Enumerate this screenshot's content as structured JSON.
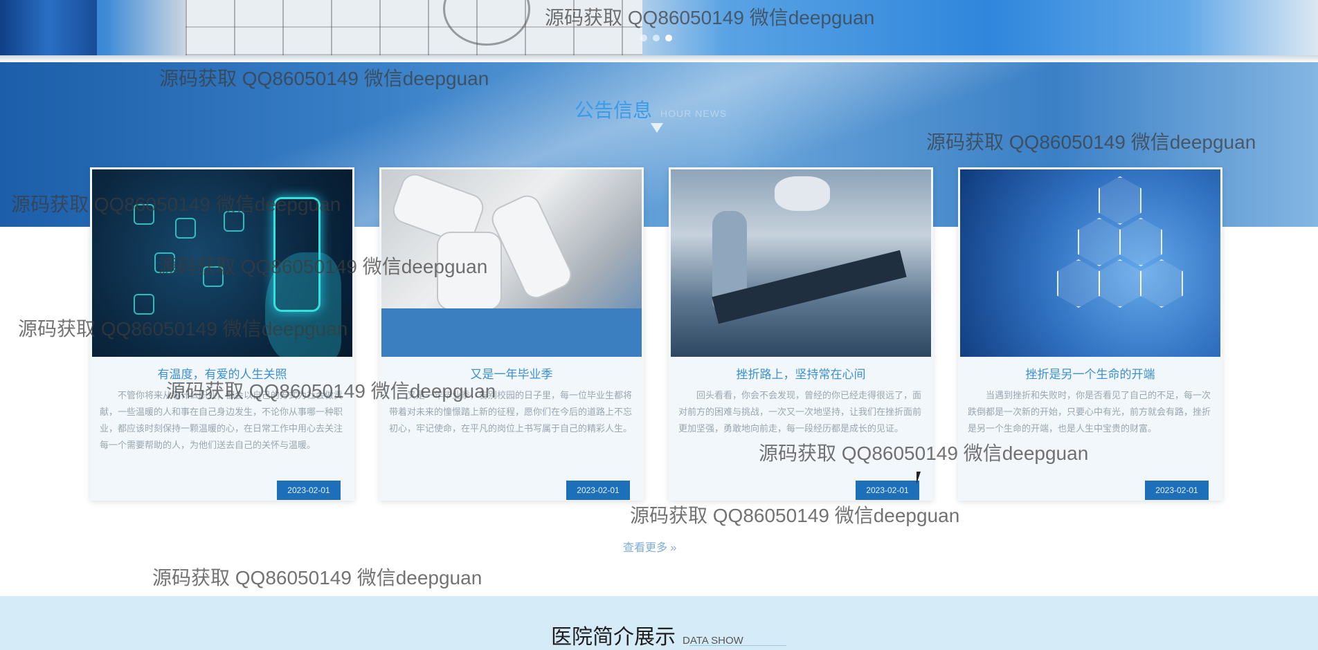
{
  "banner": {
    "slogan": "",
    "dots": 3
  },
  "news": {
    "title": "公告信息",
    "subtitle": "HOUR NEWS",
    "cards": [
      {
        "title": "有温度，有爱的人生关照",
        "summary": "不管你将来从事什么职业，都会以自己的方式为社会做贡献，一些温暖的人和事在自己身边发生，不论你从事哪一种职业，都应该时刻保持一颗温暖的心，在日常工作中用心去关注每一个需要帮助的人，为他们送去自己的关怀与温暖。",
        "date": "2023-02-01"
      },
      {
        "title": "又是一年毕业季",
        "summary": "又是一年毕业季，告别校园的日子里，每一位毕业生都将带着对未来的憧憬踏上新的征程，愿你们在今后的道路上不忘初心，牢记使命，在平凡的岗位上书写属于自己的精彩人生。",
        "date": "2023-02-01"
      },
      {
        "title": "挫折路上，坚持常在心间",
        "summary": "回头看看，你会不会发现，曾经的你已经走得很远了，面对前方的困难与挑战，一次又一次地坚持，让我们在挫折面前更加坚强，勇敢地向前走，每一段经历都是成长的见证。",
        "date": "2023-02-01"
      },
      {
        "title": "挫折是另一个生命的开端",
        "summary": "当遇到挫折和失败时，你是否看见了自己的不足，每一次跌倒都是一次新的开始，只要心中有光，前方就会有路，挫折是另一个生命的开端，也是人生中宝贵的财富。",
        "date": "2023-02-01"
      }
    ],
    "more_label": "查看更多 »"
  },
  "about": {
    "title": "医院简介展示",
    "subtitle": "DATA SHOW"
  },
  "watermark": "源码获取 QQ86050149 微信deepguan"
}
